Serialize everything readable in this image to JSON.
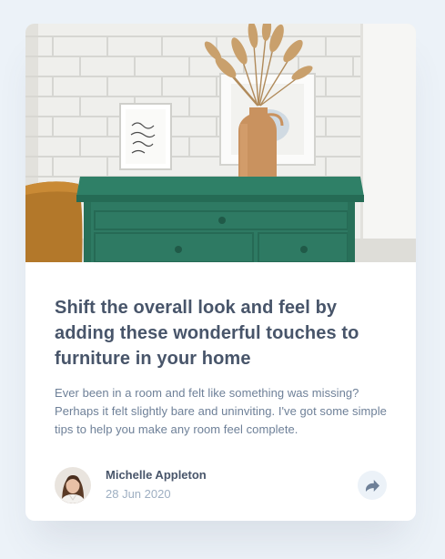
{
  "article": {
    "image_alt": "Green drawer dresser with a vase of dried grass and framed prints against a white brick wall",
    "title": "Shift the overall look and feel by adding these wonderful touches to furniture in your home",
    "excerpt": "Ever been in a room and felt like something was missing? Perhaps it felt slightly bare and uninviting. I've got some simple tips to help you make any room feel complete."
  },
  "author": {
    "name": "Michelle Appleton",
    "date": "28 Jun 2020"
  },
  "share": {
    "icon": "share-icon"
  },
  "colors": {
    "page_background": "#ecf2f8",
    "card_background": "#ffffff",
    "title_text": "#48556a",
    "body_text": "#6e8098",
    "muted_text": "#9eafc2",
    "dresser_green": "#2e7a63"
  }
}
